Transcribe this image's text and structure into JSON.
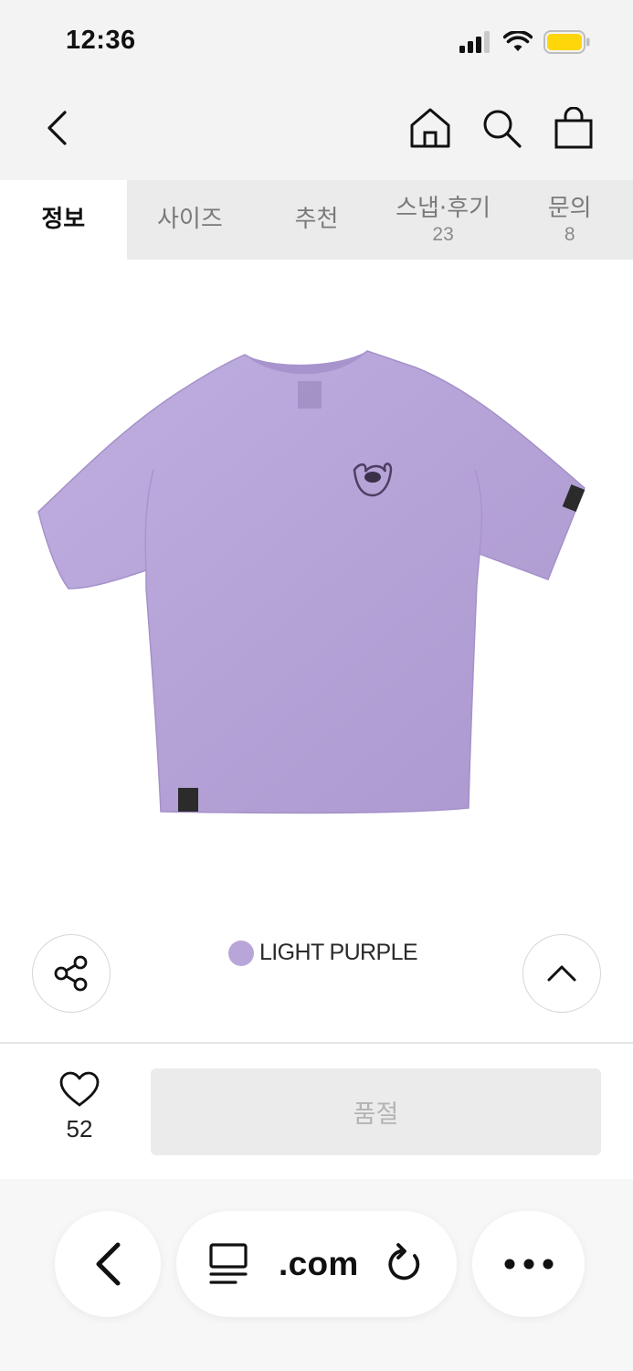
{
  "status": {
    "time": "12:36",
    "battery_color": "#ffd60a"
  },
  "header": {
    "icons": [
      "back-icon",
      "home-icon",
      "search-icon",
      "shopping-bag-icon"
    ]
  },
  "tabs": [
    {
      "label": "정보",
      "count": ""
    },
    {
      "label": "사이즈",
      "count": ""
    },
    {
      "label": "추천",
      "count": ""
    },
    {
      "label": "스냅·후기",
      "count": "23"
    },
    {
      "label": "문의",
      "count": "8"
    }
  ],
  "product": {
    "image": "purple t-shirt",
    "color_swatch": "#b8a6d8",
    "color_name": "LIGHT PURPLE",
    "tshirt_color": "#b9a7d9"
  },
  "actions": {
    "share_icon": "share-icon",
    "scroll_top_icon": "chevron-up-icon"
  },
  "purchase": {
    "like_count": "52",
    "soldout_label": "품절"
  },
  "browser": {
    "url": ".com",
    "icons": [
      "back-icon",
      "reader-icon",
      "reload-icon",
      "more-icon"
    ]
  }
}
